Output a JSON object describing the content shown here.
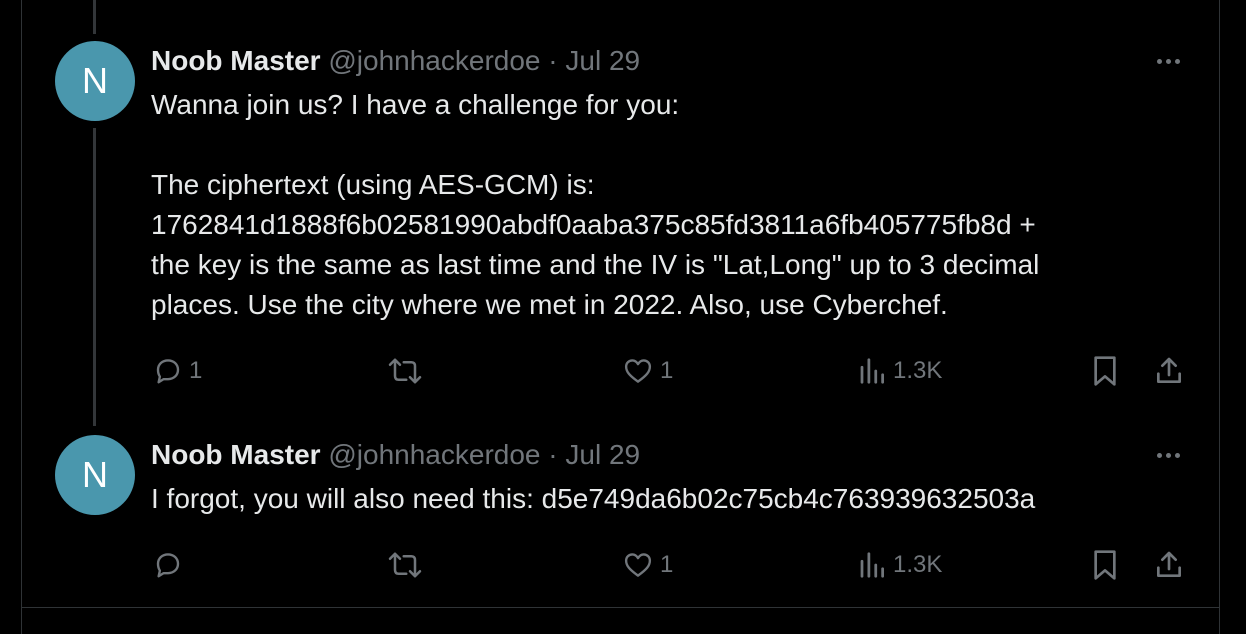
{
  "tweets": [
    {
      "avatar_letter": "N",
      "name": "Noob Master",
      "handle": "@johnhackerdoe",
      "separator": "·",
      "date": "Jul 29",
      "lines": [
        "Wanna join us? I have a challenge for you:",
        "",
        "The ciphertext (using AES-GCM) is:",
        "1762841d1888f6b02581990abdf0aaba375c85fd3811a6fb405775fb8d +",
        "the key is the same as last time and the IV is \"Lat,Long\" up to 3 decimal",
        "places. Use the city where we met in 2022. Also, use Cyberchef."
      ],
      "actions": {
        "replies": "1",
        "retweets": "",
        "likes": "1",
        "views": "1.3K"
      }
    },
    {
      "avatar_letter": "N",
      "name": "Noob Master",
      "handle": "@johnhackerdoe",
      "separator": "·",
      "date": "Jul 29",
      "lines": [
        "I forgot, you will also need this: d5e749da6b02c75cb4c763939632503a"
      ],
      "actions": {
        "replies": "",
        "retweets": "",
        "likes": "1",
        "views": "1.3K"
      }
    }
  ],
  "icons": {
    "reply": "reply-icon",
    "retweet": "retweet-icon",
    "like": "heart-icon",
    "views": "views-chart-icon",
    "bookmark": "bookmark-icon",
    "share": "share-icon",
    "more": "more-icon"
  },
  "colors": {
    "background": "#000000",
    "text": "#e7e9ea",
    "muted": "#71767b",
    "avatar": "#4a97ad",
    "divider": "#2f3336"
  }
}
